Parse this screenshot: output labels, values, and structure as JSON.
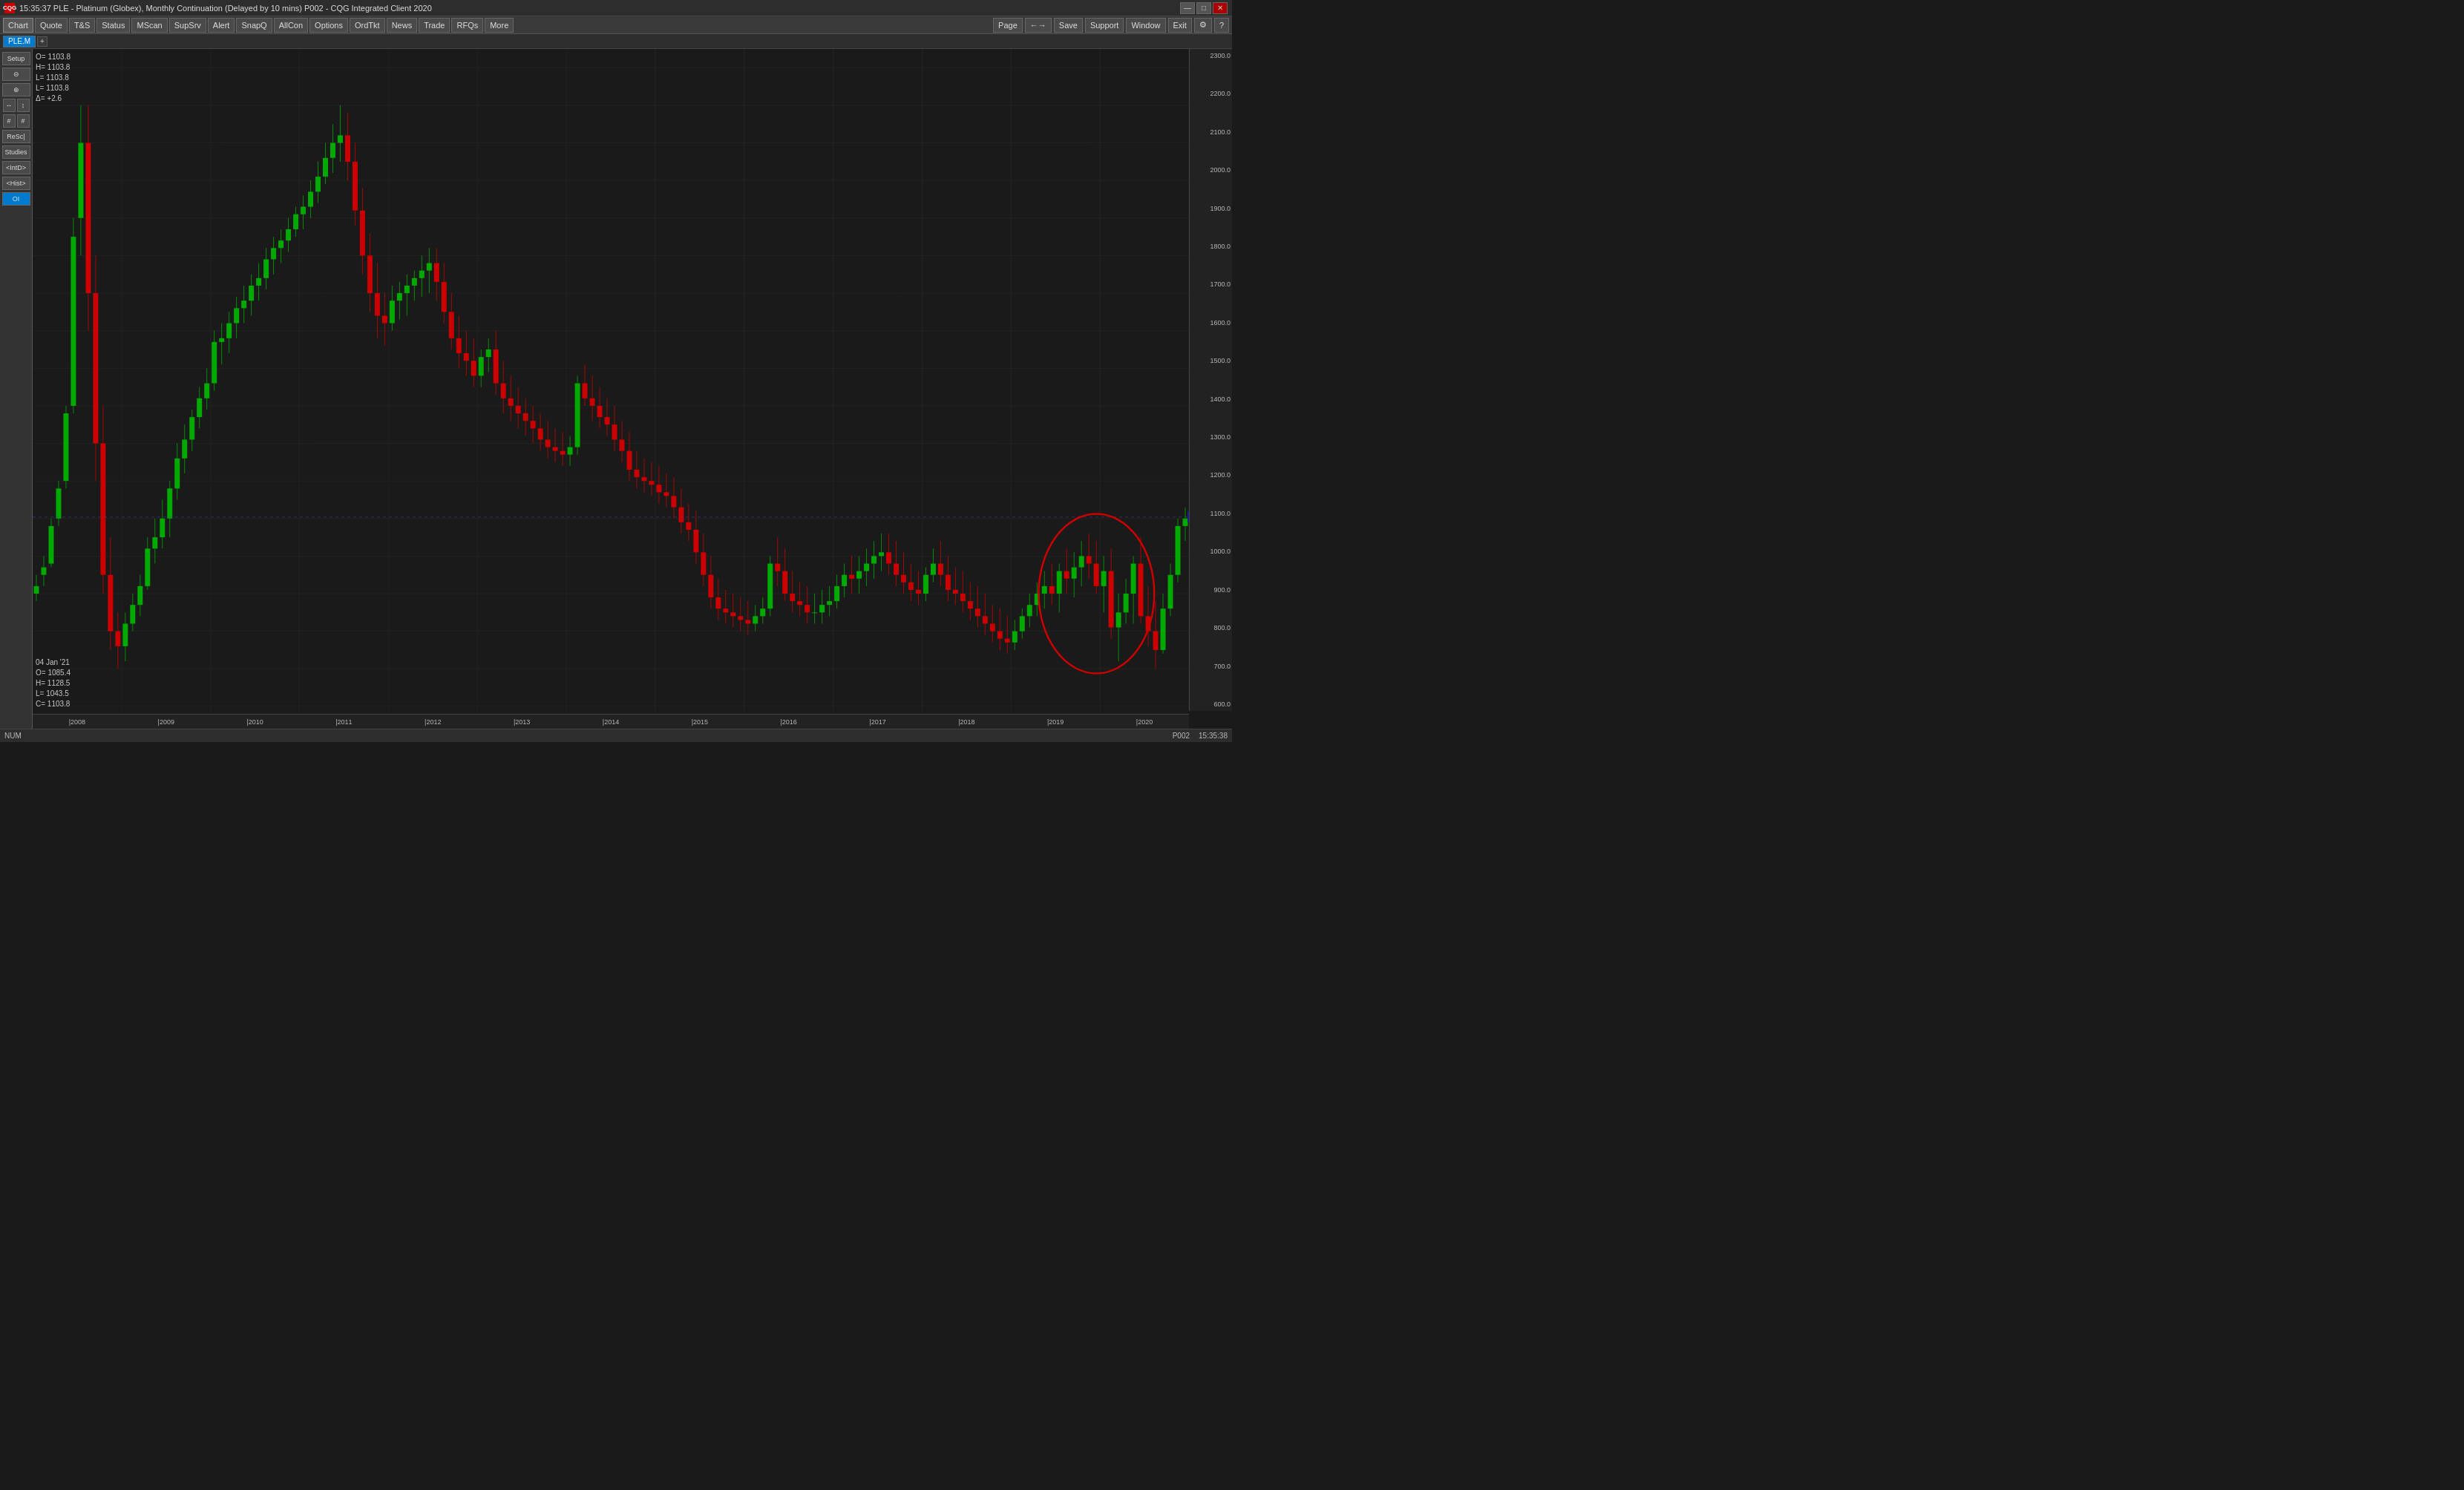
{
  "titleBar": {
    "icon": "CQG",
    "title": "15:35:37   PLE - Platinum (Globex), Monthly Continuation (Delayed by 10 mins)   P002 - CQG Integrated Client 2020",
    "minimizeLabel": "—",
    "maximizeLabel": "□",
    "closeLabel": "✕"
  },
  "menuBar": {
    "buttons": [
      "Chart",
      "Quote",
      "T&S",
      "Status",
      "MScan",
      "SupSrv",
      "Alert",
      "SnapQ",
      "AllCon",
      "Options",
      "OrdTkt",
      "News",
      "Trade",
      "RFQs",
      "More"
    ],
    "rightButtons": [
      "Page",
      "←→",
      "Save",
      "Support",
      "Window",
      "Exit",
      "⚙",
      "?"
    ]
  },
  "tabBar": {
    "tabs": [
      "PLE.M"
    ],
    "addLabel": "+"
  },
  "sidebar": {
    "setupLabel": "Setup",
    "buttons": [
      "⊖",
      "⊕",
      "↔",
      "↕",
      "ReSc|",
      "Studies",
      "<IntD>",
      "<Hist>",
      "OI"
    ]
  },
  "chartInfo": {
    "open": "O=  1103.8",
    "high": "H=  1103.8",
    "low1": "L=  1103.8",
    "low2": "L=  1103.8",
    "delta": "Δ=    +2.6"
  },
  "priceAxis": {
    "labels": [
      "2300.0",
      "2200.0",
      "2100.0",
      "2000.0",
      "1900.0",
      "1800.0",
      "1700.0",
      "1600.0",
      "1500.0",
      "1400.0",
      "1300.0",
      "1200.0",
      "1100.0",
      "1000.0",
      "900.0",
      "800.0",
      "700.0",
      "600.0"
    ],
    "highlight": "1103.8"
  },
  "timeAxis": {
    "labels": [
      "|2008",
      "|2009",
      "|2010",
      "|2011",
      "|2012",
      "|2013",
      "|2014",
      "|2015",
      "|2016",
      "|2017",
      "|2018",
      "|2019",
      "|2020"
    ]
  },
  "ohlcInfo": {
    "date": "04 Jan '21",
    "open": "O=  1085.4",
    "high": "H=  1128.5",
    "low": "L=  1043.5",
    "close": "C=  1103.8"
  },
  "statusBar": {
    "left": "NUM",
    "mid": "P002",
    "right": "15:35:38"
  },
  "colors": {
    "bullish": "#00aa00",
    "bearish": "#cc0000",
    "gridLine": "#2a2a2a",
    "background": "#1a1a1a",
    "circleColor": "#cc0000"
  }
}
